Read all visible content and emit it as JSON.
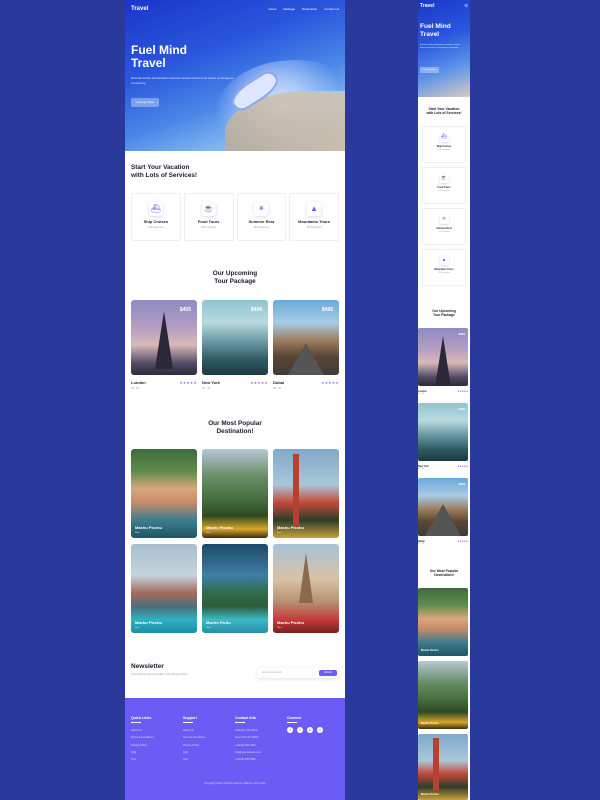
{
  "brand": "Travel",
  "nav": [
    "Home",
    "Package",
    "Destination",
    "Contact Us"
  ],
  "hero": {
    "title_line1": "Fuel Mind",
    "title_line2": "Travel",
    "text": "Extrudescently administrate customer service before best states convergence completely.",
    "cta": "Let's go Now"
  },
  "services": {
    "title_line1": "Start Your Vacation",
    "title_line2": "with Lots of Services!",
    "items": [
      {
        "name": "Ship Cruises",
        "sub": "150 Properties",
        "icon": "ship-icon"
      },
      {
        "name": "Food Tours",
        "sub": "150 Properties",
        "icon": "food-icon"
      },
      {
        "name": "Summer Rest",
        "sub": "150 Properties",
        "icon": "sun-icon"
      },
      {
        "name": "Mountains Tours",
        "sub": "150 Properties",
        "icon": "mountain-icon"
      }
    ]
  },
  "tours": {
    "title_line1": "Our Upcoming",
    "title_line2": "Tour Package",
    "items": [
      {
        "price": "$455",
        "city": "London",
        "sub": "3D - 3N",
        "stars": "★★★★★"
      },
      {
        "price": "$499",
        "city": "New York",
        "sub": "4D - 3N",
        "stars": "★★★★★"
      },
      {
        "price": "$495",
        "city": "Dubai",
        "sub": "4D - 4N",
        "stars": "★★★★★"
      }
    ]
  },
  "destinations": {
    "title_line1": "Our Most Popular",
    "title_line2": "Destination!",
    "items": [
      {
        "name": "Machu Picchu",
        "sub": "Peru"
      },
      {
        "name": "Machu Picchu",
        "sub": "Peru"
      },
      {
        "name": "Machu Picchu",
        "sub": "Peru"
      },
      {
        "name": "Machu Picchu",
        "sub": "Peru"
      },
      {
        "name": "Macho Pichu",
        "sub": "Peru"
      },
      {
        "name": "Machu Picchu",
        "sub": "Peru"
      }
    ]
  },
  "newsletter": {
    "title": "Newsletter",
    "text": "Subscribe for more free SEO and coding tutorials",
    "placeholder": "Enter your Email",
    "button": "Submit"
  },
  "footer": {
    "quick_title": "Quick Links",
    "quick_links": [
      "About Us",
      "Terms & Conditions",
      "Privacy Policy",
      "FAQ",
      "Tour"
    ],
    "support_title": "Support",
    "support_links": [
      "About Us",
      "Terms & Conditions",
      "Privacy Policy",
      "FAQ",
      "Tour"
    ],
    "contact_title": "Contact Info",
    "contact_lines": [
      "Address: 130 Street",
      "New York NY 10002",
      "+1(123) 456 7890",
      "info@yourdomain.com",
      "+1(123) 456 7890"
    ],
    "connect_title": "Connect",
    "socials": [
      "f",
      "t",
      "in",
      "ig"
    ],
    "copyright": "Copyright ©2024. All rights reserved. Made by John Smith."
  },
  "colors": {
    "accent": "#6c5cf5",
    "hero_blue": "#1a36c9",
    "background": "#2a3a9c"
  }
}
